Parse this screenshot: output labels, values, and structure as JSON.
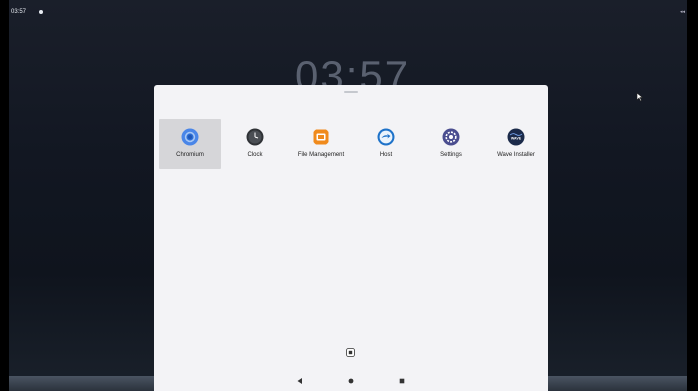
{
  "status_bar": {
    "time": "03:57"
  },
  "lock_clock": "03:57",
  "app_drawer": {
    "apps": [
      {
        "label": "Chromium",
        "icon": "chromium-icon",
        "selected": true
      },
      {
        "label": "Clock",
        "icon": "clock-icon",
        "selected": false
      },
      {
        "label": "File Management",
        "icon": "folder-icon",
        "selected": false
      },
      {
        "label": "Host",
        "icon": "host-icon",
        "selected": false
      },
      {
        "label": "Settings",
        "icon": "settings-icon",
        "selected": false
      },
      {
        "label": "Wave Installer",
        "icon": "wave-icon",
        "selected": false
      }
    ],
    "wave_icon_text": "WAVE"
  },
  "navigation": {
    "back": "back-icon",
    "home": "home-icon",
    "recents": "recents-icon"
  }
}
